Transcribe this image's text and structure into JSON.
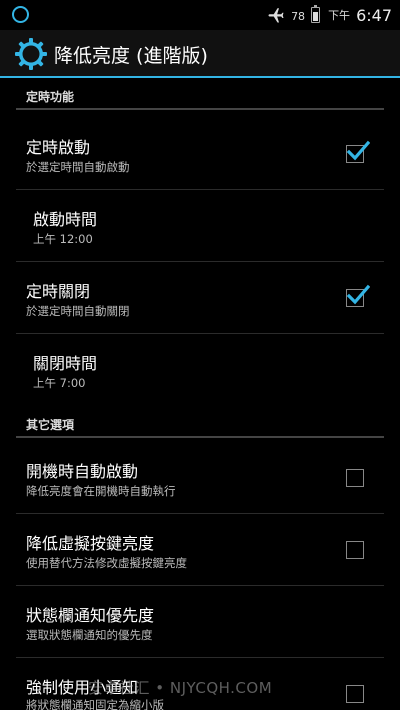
{
  "status_bar": {
    "battery_level": "78",
    "battery_fill": 0.78,
    "ampm": "下午",
    "time": "6:47",
    "icons": [
      "notification-ring-icon",
      "airplane-mode-icon",
      "battery-icon"
    ]
  },
  "action_bar": {
    "title": "降低亮度 (進階版)",
    "icon": "gear-icon",
    "accent_color": "#33b5e5"
  },
  "sections": [
    {
      "header": "定時功能",
      "items": [
        {
          "title": "定時啟動",
          "summary": "於選定時間自動啟動",
          "checked": true
        },
        {
          "title": "啟動時間",
          "summary": "上午 12:00"
        },
        {
          "title": "定時關閉",
          "summary": "於選定時間自動關閉",
          "checked": true
        },
        {
          "title": "關閉時間",
          "summary": "上午 7:00"
        }
      ]
    },
    {
      "header": "其它選項",
      "items": [
        {
          "title": "開機時自動啟動",
          "summary": "降低亮度會在開機時自動執行",
          "checked": false
        },
        {
          "title": "降低虛擬按鍵亮度",
          "summary": "使用替代方法修改虛擬按鍵亮度",
          "checked": false
        },
        {
          "title": "狀態欄通知優先度",
          "summary": "選取狀態欄通知的優先度"
        },
        {
          "title": "強制使用小通知",
          "summary": "將狀態欄通知固定為縮小版",
          "checked": false
        }
      ]
    }
  ],
  "watermark": "安卓社汇 • NJYCQH.COM"
}
